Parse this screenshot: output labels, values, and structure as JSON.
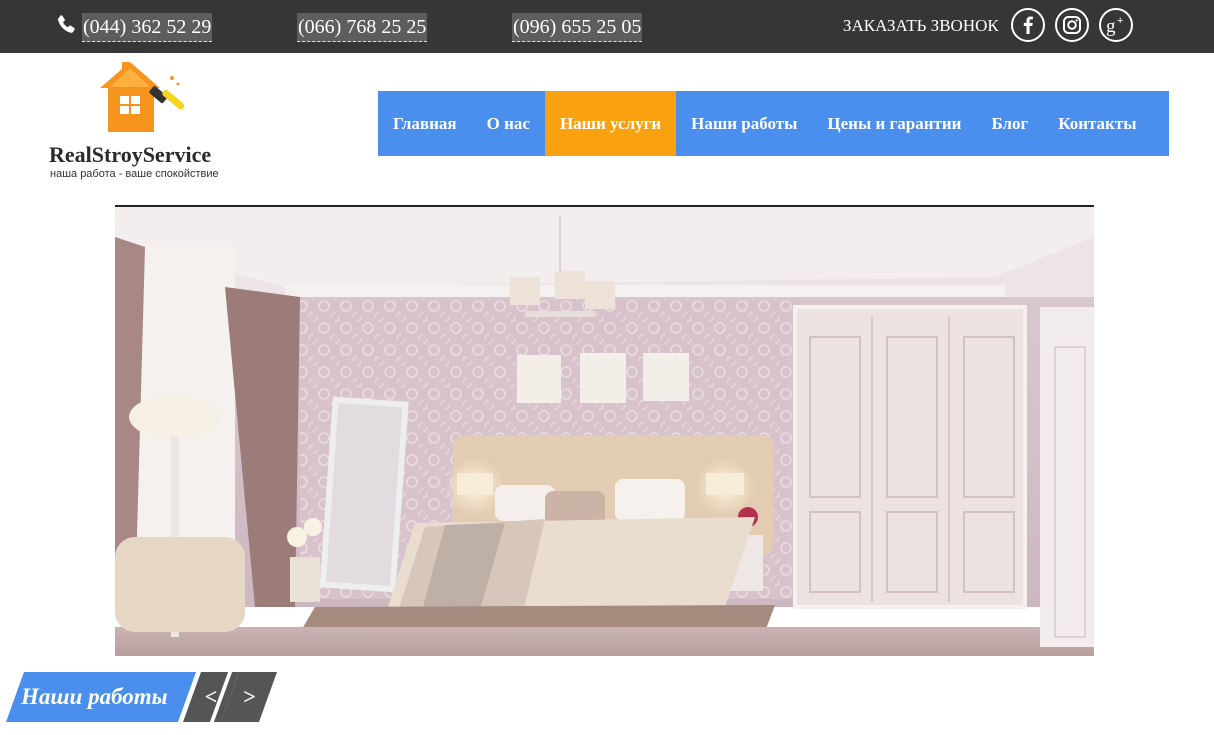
{
  "topbar": {
    "phones": [
      "(044) 362 52 29",
      "(066) 768 25 25",
      "(096) 655 25 05"
    ],
    "callback_label": "ЗАКАЗАТЬ ЗВОНОК",
    "social": [
      "facebook-icon",
      "instagram-icon",
      "google-plus-icon"
    ]
  },
  "logo": {
    "name": "RealStroyService",
    "slogan": "наша работа - ваше спокойствие"
  },
  "nav": {
    "items": [
      {
        "label": "Главная"
      },
      {
        "label": "О нас"
      },
      {
        "label": "Наши услуги",
        "active": true
      },
      {
        "label": "Наши работы"
      },
      {
        "label": "Цены и гарантии"
      },
      {
        "label": "Блог"
      },
      {
        "label": "Контакты"
      }
    ]
  },
  "section": {
    "title": "Наши работы",
    "prev_label": "<",
    "next_label": ">"
  },
  "colors": {
    "topbar": "#363636",
    "nav_blue": "#4a8fed",
    "nav_active": "#f9a10e",
    "arrow_grey": "#555555"
  }
}
